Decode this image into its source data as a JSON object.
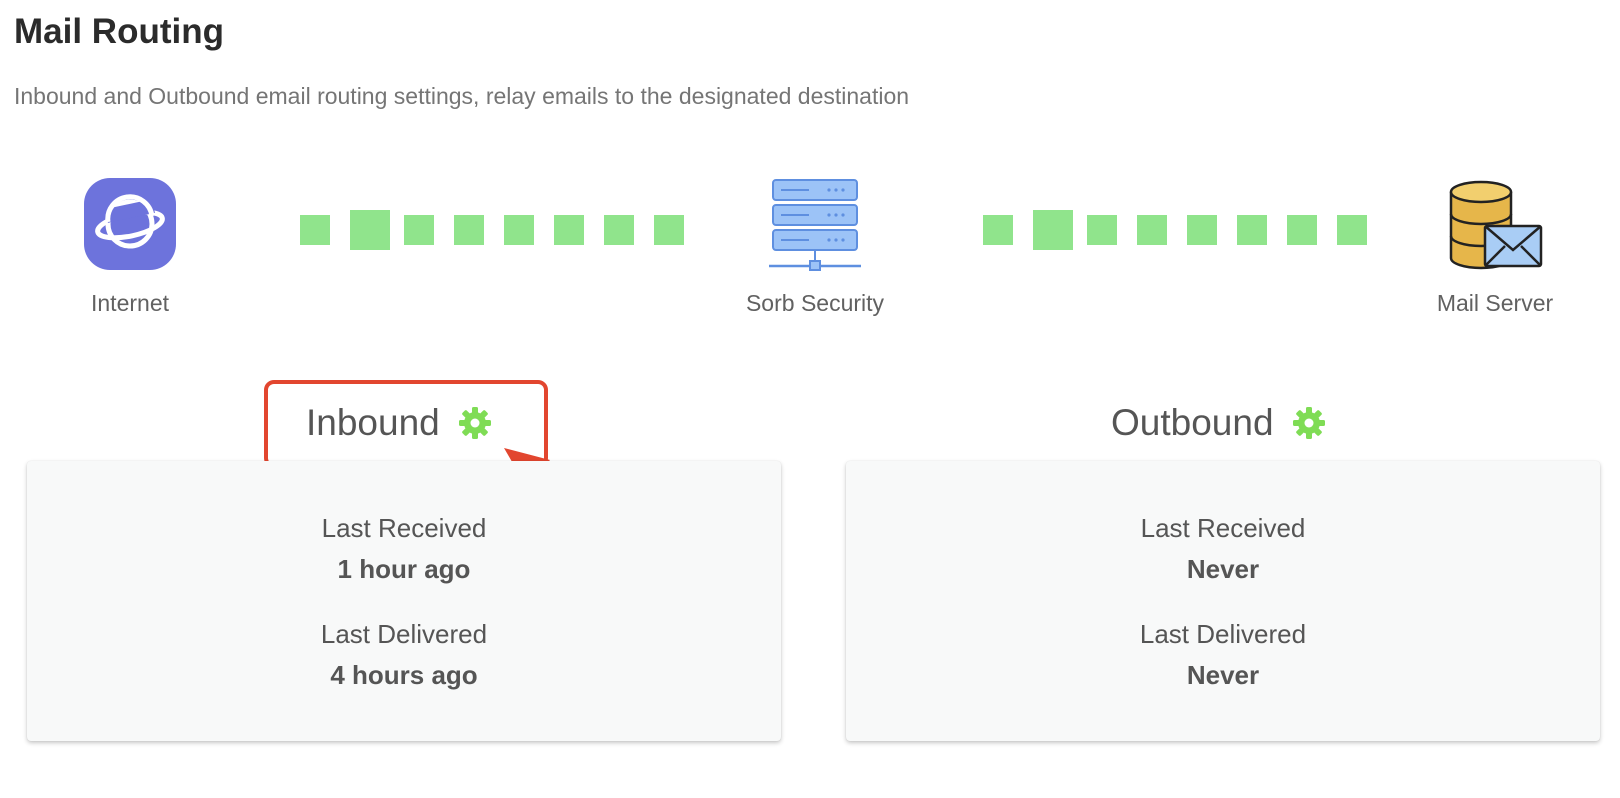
{
  "page": {
    "title": "Mail Routing",
    "subtitle": "Inbound and Outbound email routing settings, relay emails to the designated destination"
  },
  "diagram": {
    "nodes": [
      {
        "label": "Internet",
        "icon": "planet-icon"
      },
      {
        "label": "Sorb Security",
        "icon": "server-icon"
      },
      {
        "label": "Mail Server",
        "icon": "database-mail-icon"
      }
    ],
    "connector_color": "#90e48c"
  },
  "inbound": {
    "title": "Inbound",
    "settings_icon": "gear-icon",
    "last_received_label": "Last Received",
    "last_received_value": "1 hour ago",
    "last_delivered_label": "Last Delivered",
    "last_delivered_value": "4 hours ago"
  },
  "outbound": {
    "title": "Outbound",
    "settings_icon": "gear-icon",
    "last_received_label": "Last Received",
    "last_received_value": "Never",
    "last_delivered_label": "Last Delivered",
    "last_delivered_value": "Never"
  },
  "colors": {
    "accent_green": "#7fdc55",
    "annotation_red": "#e2462f",
    "internet_purple": "#6d73dc",
    "server_blue": "#6c9ff0"
  }
}
